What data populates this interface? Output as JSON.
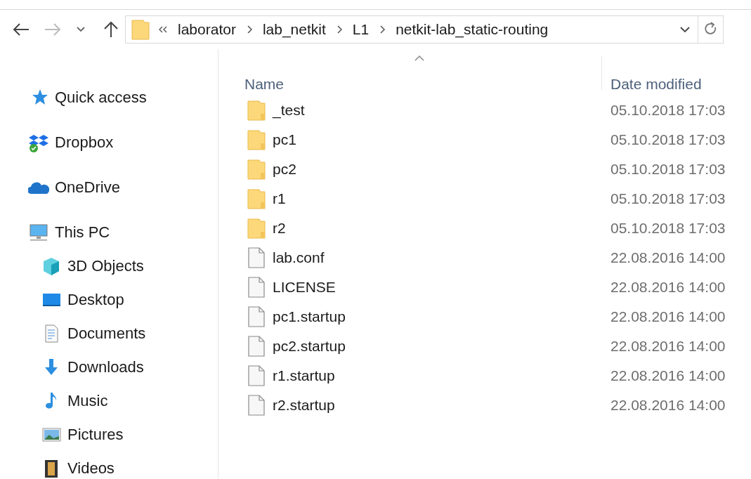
{
  "address_bar": {
    "segments": [
      "laborator",
      "lab_netkit",
      "L1",
      "netkit-lab_static-routing"
    ]
  },
  "sidebar": {
    "items": [
      {
        "label": "Quick access",
        "kind": "star"
      },
      {
        "label": "Dropbox",
        "kind": "dropbox"
      },
      {
        "label": "OneDrive",
        "kind": "cloud"
      },
      {
        "label": "This PC",
        "kind": "pc",
        "children": [
          {
            "label": "3D Objects",
            "kind": "cube"
          },
          {
            "label": "Desktop",
            "kind": "desktop"
          },
          {
            "label": "Documents",
            "kind": "document"
          },
          {
            "label": "Downloads",
            "kind": "download"
          },
          {
            "label": "Music",
            "kind": "music"
          },
          {
            "label": "Pictures",
            "kind": "pictures"
          },
          {
            "label": "Videos",
            "kind": "video"
          }
        ]
      }
    ]
  },
  "file_list": {
    "columns": [
      "Name",
      "Date modified"
    ],
    "rows": [
      {
        "name": "_test",
        "date": "05.10.2018 17:03",
        "kind": "folder"
      },
      {
        "name": "pc1",
        "date": "05.10.2018 17:03",
        "kind": "folder"
      },
      {
        "name": "pc2",
        "date": "05.10.2018 17:03",
        "kind": "folder"
      },
      {
        "name": "r1",
        "date": "05.10.2018 17:03",
        "kind": "folder"
      },
      {
        "name": "r2",
        "date": "05.10.2018 17:03",
        "kind": "folder"
      },
      {
        "name": "lab.conf",
        "date": "22.08.2016 14:00",
        "kind": "file"
      },
      {
        "name": "LICENSE",
        "date": "22.08.2016 14:00",
        "kind": "file"
      },
      {
        "name": "pc1.startup",
        "date": "22.08.2016 14:00",
        "kind": "file"
      },
      {
        "name": "pc2.startup",
        "date": "22.08.2016 14:00",
        "kind": "file"
      },
      {
        "name": "r1.startup",
        "date": "22.08.2016 14:00",
        "kind": "file"
      },
      {
        "name": "r2.startup",
        "date": "22.08.2016 14:00",
        "kind": "file"
      }
    ]
  }
}
